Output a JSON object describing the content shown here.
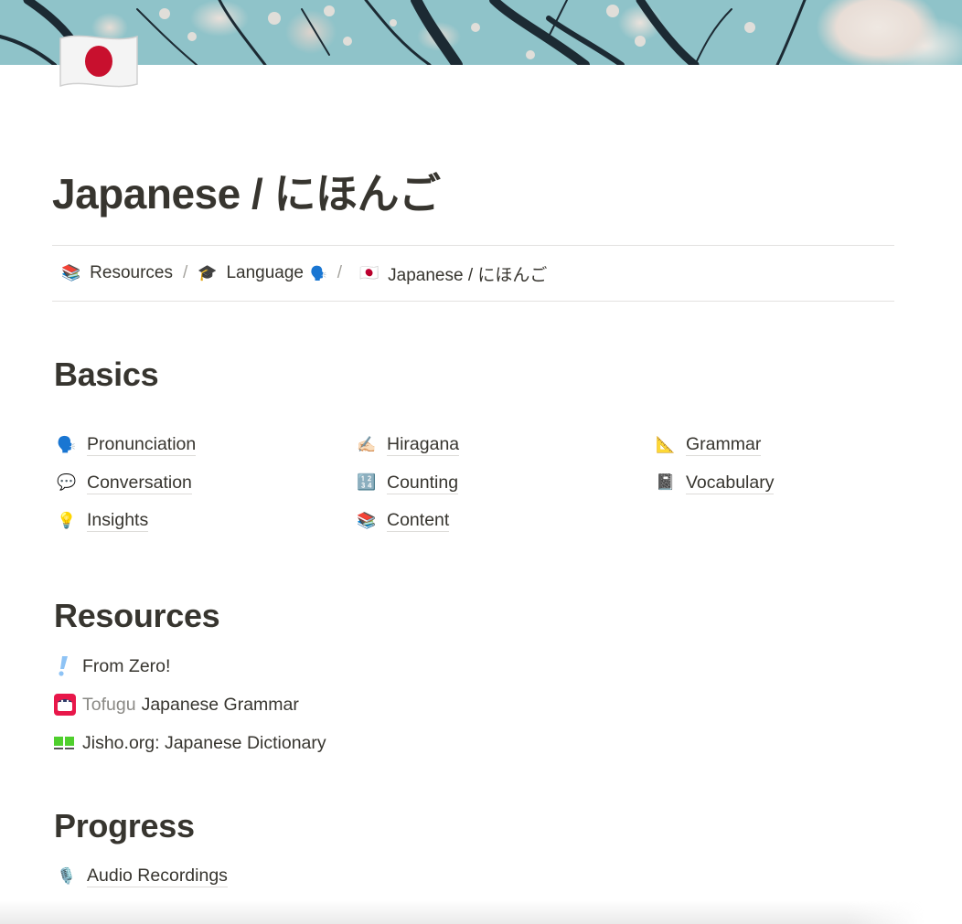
{
  "cover": {
    "description": "cherry blossom branches against blue sky"
  },
  "page_icon": {
    "emoji": "🇯🇵",
    "name": "japan-flag-icon"
  },
  "title": "Japanese / にほんご",
  "breadcrumb": [
    {
      "icon": "📚",
      "icon_name": "books-icon",
      "label": "Resources"
    },
    {
      "icon": "🎓",
      "icon_name": "graduation-cap-icon",
      "label": "Language",
      "trailing_icon": "🗣️",
      "trailing_icon_name": "speaking-head-icon"
    },
    {
      "icon": "🇯🇵",
      "icon_name": "japan-flag-icon",
      "label": "Japanese / にほんご"
    }
  ],
  "breadcrumb_separator": "/",
  "sections": {
    "basics": {
      "heading": "Basics",
      "columns": [
        [
          {
            "icon": "🗣️",
            "icon_name": "speaking-head-icon",
            "label": "Pronunciation"
          },
          {
            "icon": "💬",
            "icon_name": "speech-bubble-icon",
            "label": "Conversation"
          },
          {
            "icon": "💡",
            "icon_name": "light-bulb-icon",
            "label": "Insights"
          }
        ],
        [
          {
            "icon": "✍🏻",
            "icon_name": "writing-hand-icon",
            "label": "Hiragana"
          },
          {
            "icon": "🔢",
            "icon_name": "numbers-icon",
            "label": "Counting"
          },
          {
            "icon": "📚",
            "icon_name": "books-icon",
            "label": "Content"
          }
        ],
        [
          {
            "icon": "📐",
            "icon_name": "triangle-ruler-icon",
            "label": "Grammar"
          },
          {
            "icon": "📓",
            "icon_name": "notebook-icon",
            "label": "Vocabulary"
          }
        ]
      ]
    },
    "resources": {
      "heading": "Resources",
      "items": [
        {
          "icon_name": "exclamation-icon",
          "prefix": "",
          "label": "From Zero!"
        },
        {
          "icon_name": "tofugu-logo-icon",
          "prefix": "Tofugu",
          "label": "Japanese Grammar"
        },
        {
          "icon_name": "jisho-book-icon",
          "prefix": "",
          "label": "Jisho.org: Japanese Dictionary"
        }
      ]
    },
    "progress": {
      "heading": "Progress",
      "items": [
        {
          "icon": "🎙️",
          "icon_name": "microphone-icon",
          "label": "Audio Recordings"
        }
      ]
    }
  },
  "colors": {
    "text": "#37352f",
    "muted": "#8a8985",
    "divider": "#e3e2e0",
    "japan_red": "#c8102e",
    "tofugu_red": "#e8174a",
    "jisho_green": "#4fcf2d",
    "from_zero_blue": "#8ec3f5"
  }
}
